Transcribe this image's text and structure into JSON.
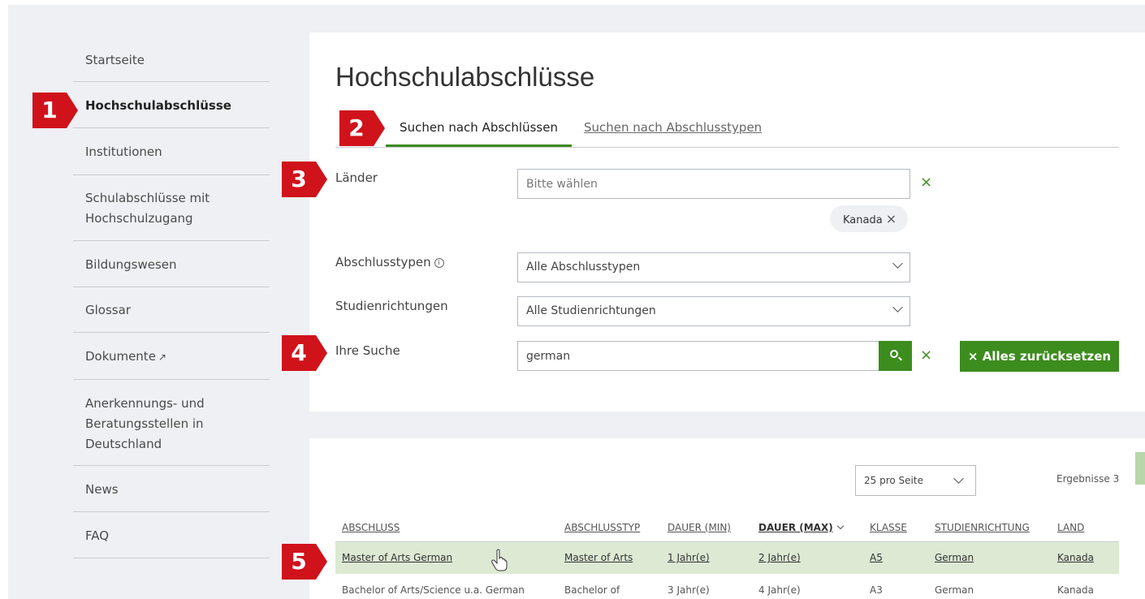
{
  "sidebar": {
    "items": [
      {
        "label": "Startseite"
      },
      {
        "label": "Hochschulabschlüsse"
      },
      {
        "label": "Institutionen"
      },
      {
        "label": "Schulabschlüsse mit",
        "label2": "Hochschulzugang"
      },
      {
        "label": "Bildungswesen"
      },
      {
        "label": "Glossar"
      },
      {
        "label": "Dokumente"
      },
      {
        "label": "Anerkennungs- und",
        "label2": "Beratungsstellen in",
        "label3": "Deutschland"
      },
      {
        "label": "News"
      },
      {
        "label": "FAQ"
      }
    ]
  },
  "page": {
    "title": "Hochschulabschlüsse"
  },
  "tabs": [
    {
      "label": "Suchen nach Abschlüssen"
    },
    {
      "label": "Suchen nach Abschlusstypen"
    }
  ],
  "form": {
    "laender": {
      "label": "Länder",
      "placeholder": "Bitte wählen",
      "chip": "Kanada"
    },
    "abschlusstypen": {
      "label": "Abschlusstypen",
      "value": "Alle Abschlusstypen"
    },
    "studienrichtungen": {
      "label": "Studienrichtungen",
      "value": "Alle Studienrichtungen"
    },
    "suche": {
      "label": "Ihre Suche",
      "value": "german"
    },
    "reset_label": "Alles zurücksetzen",
    "clear_glyph": "×"
  },
  "markers": [
    "1",
    "2",
    "3",
    "4",
    "5"
  ],
  "results": {
    "per_page": "25 pro Seite",
    "count_text": "Ergebnisse 3",
    "columns": [
      "ABSCHLUSS",
      "ABSCHLUSSTYP",
      "DAUER (MIN)",
      "DAUER (MAX)",
      "KLASSE",
      "STUDIENRICHTUNG",
      "LAND"
    ],
    "rows": [
      [
        "Master of Arts German",
        "Master of Arts",
        "1 Jahr(e)",
        "2 Jahr(e)",
        "A5",
        "German",
        "Kanada"
      ],
      [
        "Bachelor of Arts/Science u.a. German",
        "Bachelor of",
        "3 Jahr(e)",
        "4 Jahr(e)",
        "A3",
        "German",
        "Kanada"
      ]
    ]
  },
  "colors": {
    "accent": "#3c8c1e",
    "marker": "#d0121b",
    "highlight": "#dde9d3"
  }
}
